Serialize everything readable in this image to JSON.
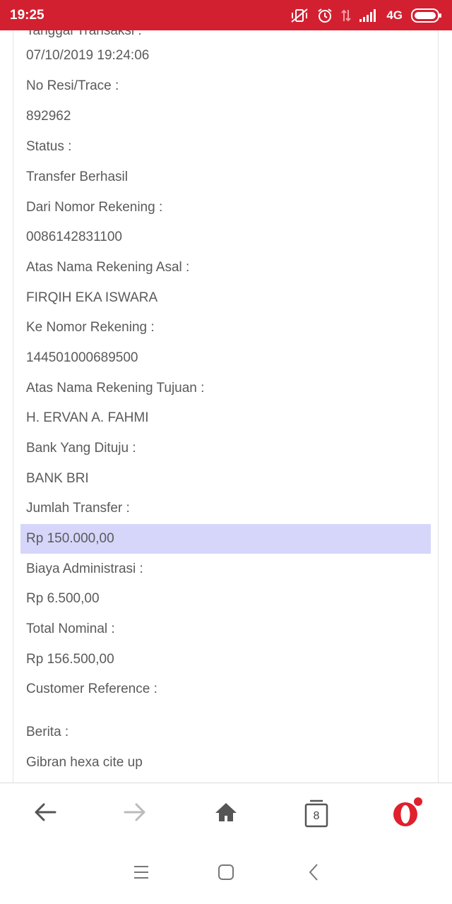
{
  "status_bar": {
    "time": "19:25",
    "network": "4G"
  },
  "details": [
    {
      "text": "Tanggal Transaksi :",
      "highlight": false
    },
    {
      "text": "07/10/2019 19:24:06",
      "highlight": false
    },
    {
      "text": "No Resi/Trace :",
      "highlight": false
    },
    {
      "text": "892962",
      "highlight": false
    },
    {
      "text": "Status :",
      "highlight": false
    },
    {
      "text": "Transfer Berhasil",
      "highlight": false
    },
    {
      "text": "Dari Nomor Rekening :",
      "highlight": false
    },
    {
      "text": "0086142831100",
      "highlight": false
    },
    {
      "text": "Atas Nama Rekening Asal :",
      "highlight": false
    },
    {
      "text": "FIRQIH EKA ISWARA",
      "highlight": false
    },
    {
      "text": "Ke Nomor Rekening :",
      "highlight": false
    },
    {
      "text": "144501000689500",
      "highlight": false
    },
    {
      "text": "Atas Nama Rekening Tujuan :",
      "highlight": false
    },
    {
      "text": "H. ERVAN A. FAHMI",
      "highlight": false
    },
    {
      "text": "Bank Yang Dituju :",
      "highlight": false
    },
    {
      "text": "BANK BRI",
      "highlight": false
    },
    {
      "text": "Jumlah Transfer :",
      "highlight": false
    },
    {
      "text": "Rp 150.000,00",
      "highlight": true
    },
    {
      "text": "Biaya Administrasi :",
      "highlight": false
    },
    {
      "text": "Rp 6.500,00",
      "highlight": false
    },
    {
      "text": "Total Nominal :",
      "highlight": false
    },
    {
      "text": "Rp 156.500,00",
      "highlight": false
    },
    {
      "text": "Customer Reference :",
      "highlight": false
    },
    {
      "text": "",
      "highlight": false
    },
    {
      "text": "Berita :",
      "highlight": false
    },
    {
      "text": "Gibran hexa cite up",
      "highlight": false
    }
  ],
  "toolbar": {
    "tab_count": "8",
    "icons": [
      "back-arrow-icon",
      "forward-arrow-icon",
      "home-icon",
      "tabs-icon",
      "opera-logo-icon"
    ],
    "accent_color": "#e0202d",
    "highlight_color": "#d6d6fb"
  },
  "navbar": {
    "icons": [
      "menu-icon",
      "home-square-icon",
      "back-chevron-icon"
    ]
  }
}
